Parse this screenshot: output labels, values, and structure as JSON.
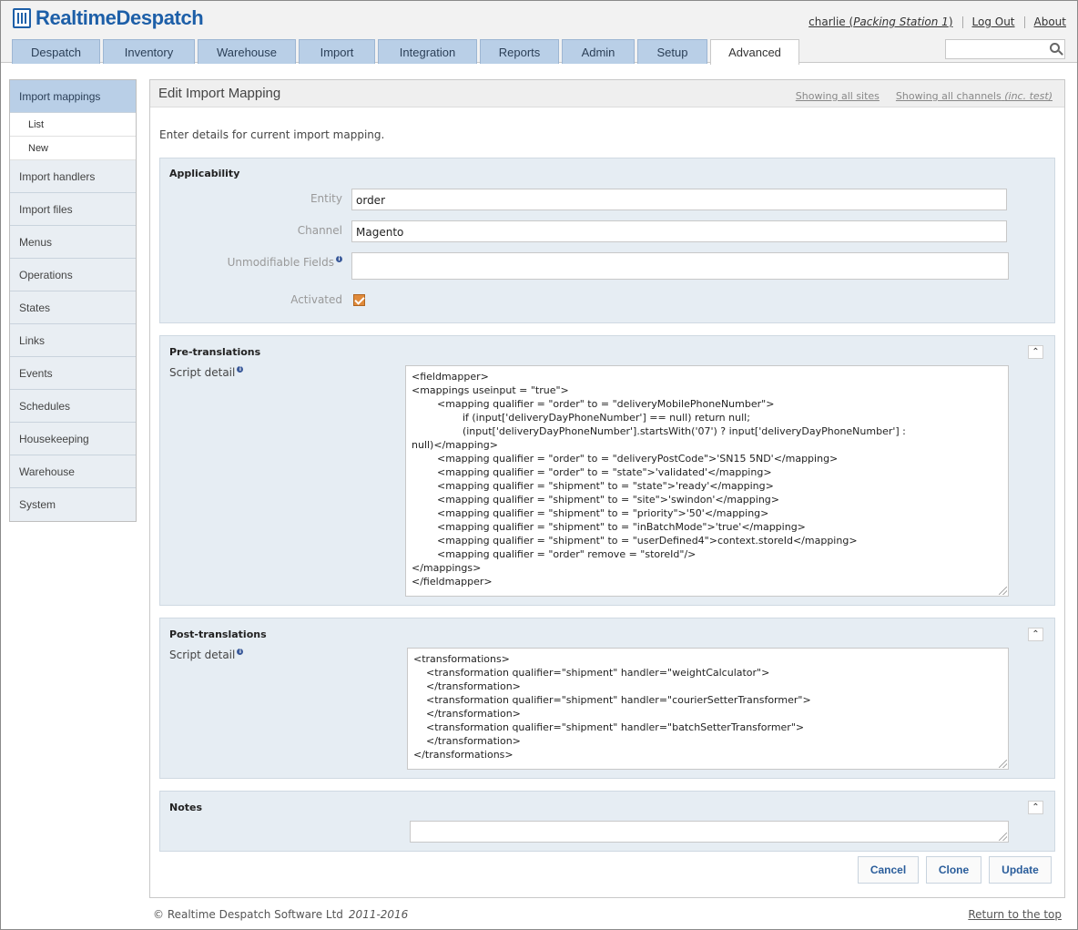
{
  "app": {
    "logo_text": "RealtimeDespatch"
  },
  "user": {
    "name": "charlie",
    "station": "Packing Station 1",
    "logout": "Log Out",
    "about": "About"
  },
  "tabs": [
    "Despatch",
    "Inventory",
    "Warehouse",
    "Import",
    "Integration",
    "Reports",
    "Admin",
    "Setup",
    "Advanced"
  ],
  "active_tab": "Advanced",
  "search": {
    "placeholder": "",
    "icon": "search-icon"
  },
  "sidebar": {
    "items": [
      "Import mappings",
      "Import handlers",
      "Import files",
      "Menus",
      "Operations",
      "States",
      "Links",
      "Events",
      "Schedules",
      "Housekeeping",
      "Warehouse",
      "System"
    ],
    "subitems": [
      "List",
      "New"
    ]
  },
  "page": {
    "title": "Edit Import Mapping",
    "sites_link": "Showing all sites",
    "channels_link": "Showing all channels",
    "channels_note": "(inc. test)",
    "intro": "Enter details for current import mapping."
  },
  "applicability": {
    "title": "Applicability",
    "entity_label": "Entity",
    "entity_value": "order",
    "channel_label": "Channel",
    "channel_value": "Magento",
    "unmodifiable_label": "Unmodifiable Fields",
    "unmodifiable_value": "",
    "activated_label": "Activated",
    "activated": true
  },
  "pre": {
    "title": "Pre-translations",
    "label": "Script detail",
    "script": "<fieldmapper>\n<mappings useinput = \"true\">\n        <mapping qualifier = \"order\" to = \"deliveryMobilePhoneNumber\">\n                if (input['deliveryDayPhoneNumber'] == null) return null;\n                (input['deliveryDayPhoneNumber'].startsWith('07') ? input['deliveryDayPhoneNumber'] :\nnull)</mapping>\n        <mapping qualifier = \"order\" to = \"deliveryPostCode\">'SN15 5ND'</mapping>\n        <mapping qualifier = \"order\" to = \"state\">'validated'</mapping>\n        <mapping qualifier = \"shipment\" to = \"state\">'ready'</mapping>\n        <mapping qualifier = \"shipment\" to = \"site\">'swindon'</mapping>\n        <mapping qualifier = \"shipment\" to = \"priority\">'50'</mapping>\n        <mapping qualifier = \"shipment\" to = \"inBatchMode\">'true'</mapping>\n        <mapping qualifier = \"shipment\" to = \"userDefined4\">context.storeId</mapping>\n        <mapping qualifier = \"order\" remove = \"storeId\"/>\n</mappings>\n</fieldmapper>"
  },
  "post": {
    "title": "Post-translations",
    "label": "Script detail",
    "script": "<transformations>\n    <transformation qualifier=\"shipment\" handler=\"weightCalculator\">\n    </transformation>\n    <transformation qualifier=\"shipment\" handler=\"courierSetterTransformer\">\n    </transformation>\n    <transformation qualifier=\"shipment\" handler=\"batchSetterTransformer\">\n    </transformation>\n</transformations>"
  },
  "notes": {
    "title": "Notes",
    "value": ""
  },
  "buttons": {
    "cancel": "Cancel",
    "clone": "Clone",
    "update": "Update"
  },
  "footer": {
    "copyright": "© Realtime Despatch Software Ltd",
    "years": "2011-2016",
    "return": "Return to the top"
  }
}
